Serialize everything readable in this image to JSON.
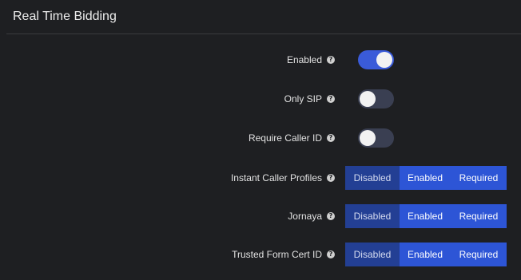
{
  "header": {
    "title": "Real Time Bidding"
  },
  "settings": {
    "enabled": {
      "label": "Enabled",
      "state": "on"
    },
    "only_sip": {
      "label": "Only SIP",
      "state": "off"
    },
    "require_caller_id": {
      "label": "Require Caller ID",
      "state": "off"
    },
    "instant_caller_profiles": {
      "label": "Instant Caller Profiles",
      "options": [
        "Disabled",
        "Enabled",
        "Required"
      ],
      "selected": "Disabled"
    },
    "jornaya": {
      "label": "Jornaya",
      "options": [
        "Disabled",
        "Enabled",
        "Required"
      ],
      "selected": "Disabled"
    },
    "trusted_form_cert_id": {
      "label": "Trusted Form Cert ID",
      "options": [
        "Disabled",
        "Enabled",
        "Required"
      ],
      "selected": "Disabled"
    }
  },
  "help_icon": {
    "glyph": "?",
    "icon": "question-circle-icon"
  },
  "colors": {
    "background": "#1e1f22",
    "toggle_on": "#3a5bd9",
    "toggle_off": "#3a3f52",
    "segment": "#2d55d6",
    "segment_selected": "#233f94"
  }
}
